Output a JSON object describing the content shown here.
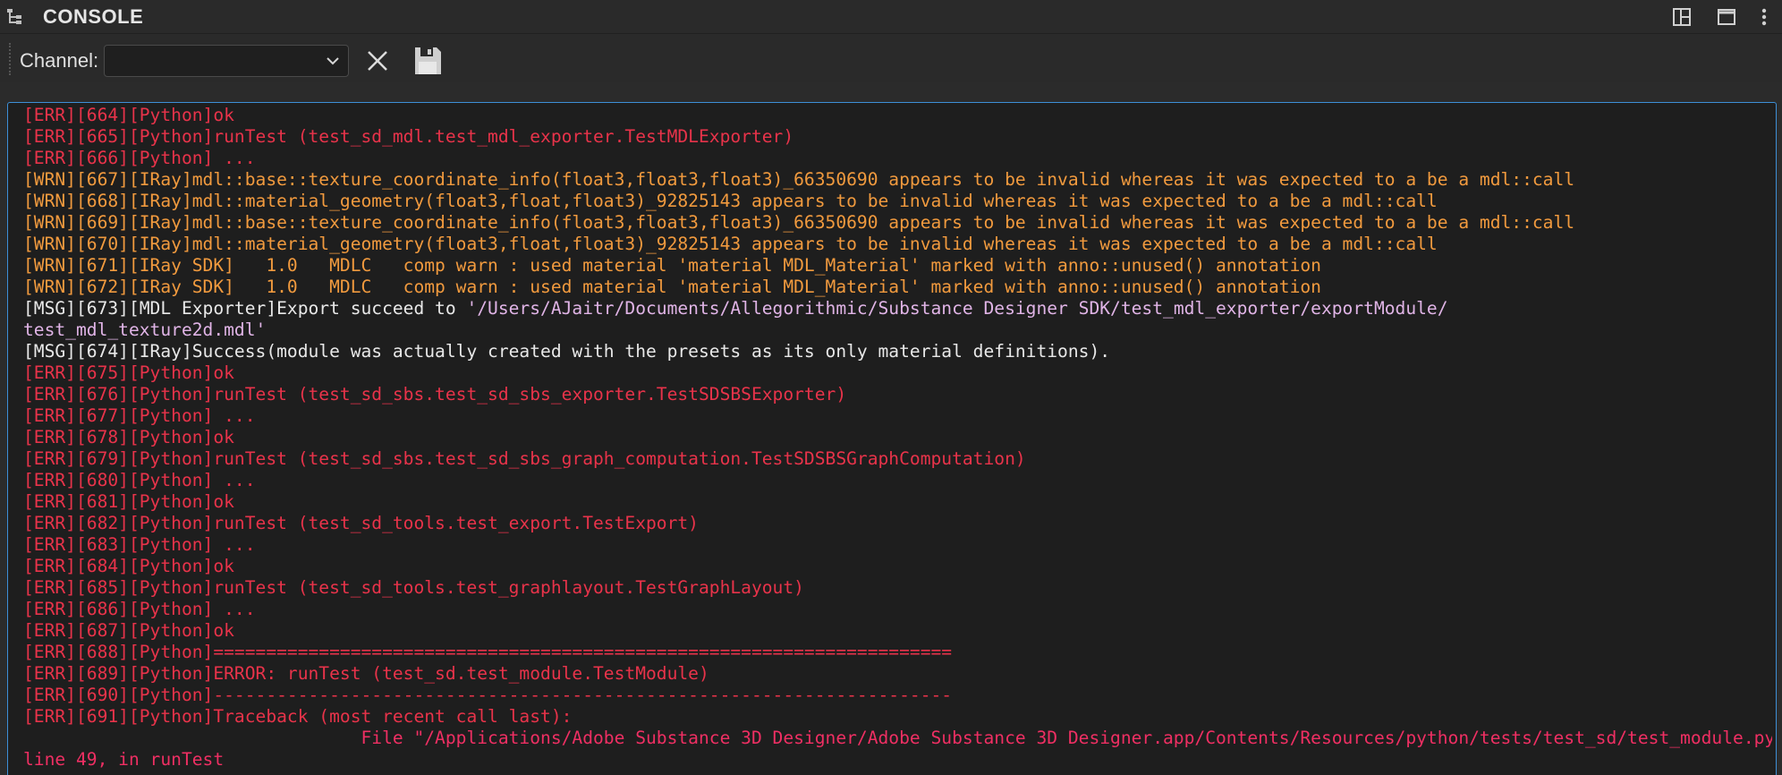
{
  "title": "CONSOLE",
  "toolbar": {
    "channel_label": "Channel:",
    "channel_value": ""
  },
  "log_lines": [
    {
      "level": "err",
      "text": "[ERR][664][Python]ok"
    },
    {
      "level": "err",
      "text": "[ERR][665][Python]runTest (test_sd_mdl.test_mdl_exporter.TestMDLExporter)"
    },
    {
      "level": "err",
      "text": "[ERR][666][Python] ..."
    },
    {
      "level": "wrn",
      "text": "[WRN][667][IRay]mdl::base::texture_coordinate_info(float3,float3,float3)_66350690 appears to be invalid whereas it was expected to a be a mdl::call"
    },
    {
      "level": "wrn",
      "text": "[WRN][668][IRay]mdl::material_geometry(float3,float,float3)_92825143 appears to be invalid whereas it was expected to a be a mdl::call"
    },
    {
      "level": "wrn",
      "text": "[WRN][669][IRay]mdl::base::texture_coordinate_info(float3,float3,float3)_66350690 appears to be invalid whereas it was expected to a be a mdl::call"
    },
    {
      "level": "wrn",
      "text": "[WRN][670][IRay]mdl::material_geometry(float3,float,float3)_92825143 appears to be invalid whereas it was expected to a be a mdl::call"
    },
    {
      "level": "wrn",
      "text": "[WRN][671][IRay SDK]   1.0   MDLC   comp warn : used material 'material MDL_Material' marked with anno::unused() annotation"
    },
    {
      "level": "wrn",
      "text": "[WRN][672][IRay SDK]   1.0   MDLC   comp warn : used material 'material MDL_Material' marked with anno::unused() annotation"
    },
    {
      "level": "msg",
      "text": "[MSG][673][MDL Exporter]Export succeed to ",
      "path": "'/Users/AJaitr/Documents/Allegorithmic/Substance Designer SDK/test_mdl_exporter/exportModule/"
    },
    {
      "level": "path",
      "text": "test_mdl_texture2d.mdl'"
    },
    {
      "level": "msg",
      "text": "[MSG][674][IRay]Success(module was actually created with the presets as its only material definitions)."
    },
    {
      "level": "err",
      "text": "[ERR][675][Python]ok"
    },
    {
      "level": "err",
      "text": "[ERR][676][Python]runTest (test_sd_sbs.test_sd_sbs_exporter.TestSDSBSExporter)"
    },
    {
      "level": "err",
      "text": "[ERR][677][Python] ..."
    },
    {
      "level": "err",
      "text": "[ERR][678][Python]ok"
    },
    {
      "level": "err",
      "text": "[ERR][679][Python]runTest (test_sd_sbs.test_sd_sbs_graph_computation.TestSDSBSGraphComputation)"
    },
    {
      "level": "err",
      "text": "[ERR][680][Python] ..."
    },
    {
      "level": "err",
      "text": "[ERR][681][Python]ok"
    },
    {
      "level": "err",
      "text": "[ERR][682][Python]runTest (test_sd_tools.test_export.TestExport)"
    },
    {
      "level": "err",
      "text": "[ERR][683][Python] ..."
    },
    {
      "level": "err",
      "text": "[ERR][684][Python]ok"
    },
    {
      "level": "err",
      "text": "[ERR][685][Python]runTest (test_sd_tools.test_graphlayout.TestGraphLayout)"
    },
    {
      "level": "err",
      "text": "[ERR][686][Python] ..."
    },
    {
      "level": "err",
      "text": "[ERR][687][Python]ok"
    },
    {
      "level": "err",
      "text": "[ERR][688][Python]======================================================================"
    },
    {
      "level": "err",
      "text": "[ERR][689][Python]ERROR: runTest (test_sd.test_module.TestModule)"
    },
    {
      "level": "err",
      "text": "[ERR][690][Python]----------------------------------------------------------------------"
    },
    {
      "level": "err",
      "text": "[ERR][691][Python]Traceback (most recent call last):"
    },
    {
      "level": "tb",
      "text": "                                File \"/Applications/Adobe Substance 3D Designer/Adobe Substance 3D Designer.app/Contents/Resources/python/tests/test_sd/test_module.py\","
    },
    {
      "level": "tb",
      "text": "line 49, in runTest"
    }
  ],
  "colors": {
    "err": "#e8334a",
    "wrn": "#f19a3e",
    "msg": "#e8e8e8",
    "path": "#e0b4e6",
    "accent": "#3d8fd6"
  }
}
